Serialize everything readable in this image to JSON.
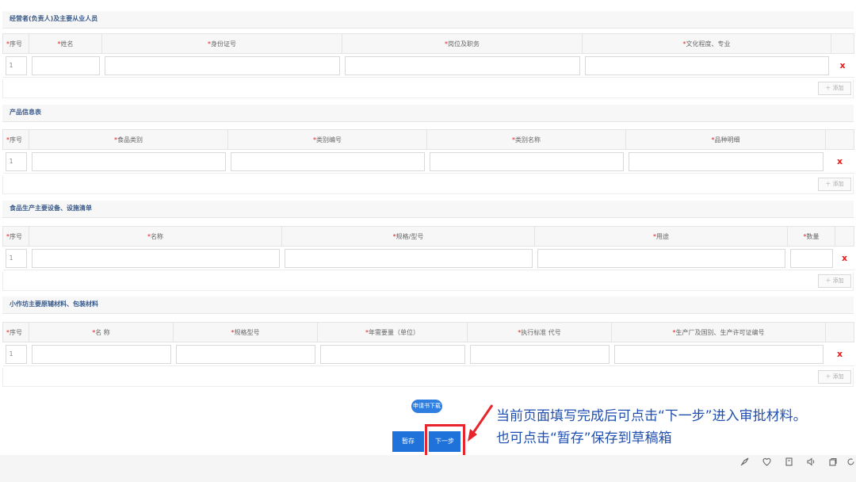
{
  "sections": [
    {
      "title": "经营者(负责人)及主要从业人员",
      "columns": [
        "序号",
        "姓名",
        "身份证号",
        "岗位及职务",
        "文化程度、专业"
      ],
      "row_index": "1"
    },
    {
      "title": "产品信息表",
      "columns": [
        "序号",
        "食品类别",
        "类别编号",
        "类别名称",
        "品种明细"
      ],
      "row_index": "1"
    },
    {
      "title": "食品生产主要设备、设施清单",
      "columns": [
        "序号",
        "名称",
        "规格/型号",
        "用途",
        "数量"
      ],
      "row_index": "1"
    },
    {
      "title": "小作坊主要原辅材料、包装材料",
      "columns": [
        "序号",
        "名 称",
        "规格型号",
        "年需要量（单位）",
        "执行标准 代号",
        "生产厂及国别、生产许可证编号"
      ],
      "row_index": "1"
    }
  ],
  "delete_mark": "x",
  "add_label": "＋ 添加",
  "required_mark": "*",
  "download_label": "申请书下载",
  "save_label": "暂存",
  "next_label": "下一步",
  "note_line1": "当前页面填写完成后可点击“下一步”进入审批材料。",
  "note_line2": "也可点击“暂存”保存到草稿箱",
  "colors": {
    "primary": "#1f72d9",
    "highlight": "#e8242c",
    "note": "#1f4fb0",
    "required": "#e02020"
  }
}
